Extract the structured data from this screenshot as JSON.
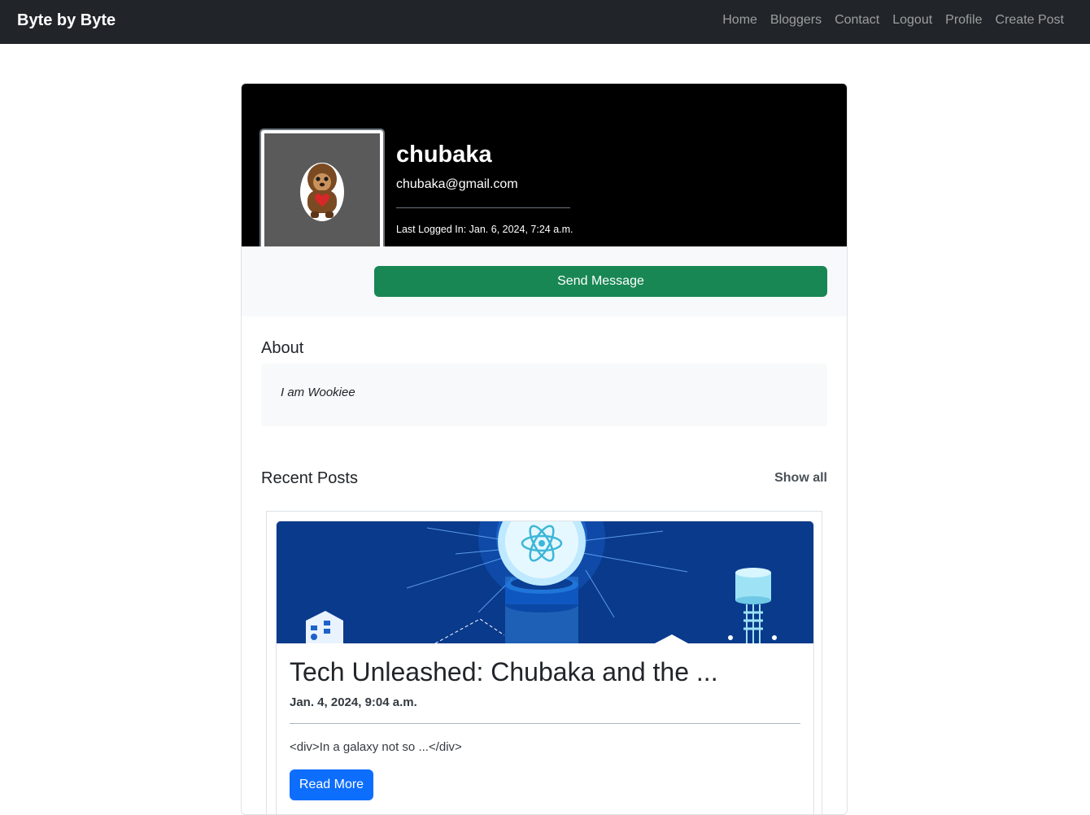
{
  "navbar": {
    "brand": "Byte by Byte",
    "links": [
      "Home",
      "Bloggers",
      "Contact",
      "Logout",
      "Profile",
      "Create Post"
    ]
  },
  "profile": {
    "username": "chubaka",
    "email": "chubaka@gmail.com",
    "last_logged_in": "Last Logged In: Jan. 6, 2024, 7:24 a.m.",
    "avatar_icon": "wookiee-sticker-icon",
    "send_message_label": "Send Message"
  },
  "about": {
    "heading": "About",
    "text": "I am Wookiee"
  },
  "recent_posts": {
    "heading": "Recent Posts",
    "show_all_label": "Show all",
    "posts": [
      {
        "title": "Tech Unleashed: Chubaka and the ...",
        "date": "Jan. 4, 2024, 9:04 a.m.",
        "excerpt": "<div>In a galaxy not so ...</div>",
        "read_more_label": "Read More",
        "image_icon": "tech-illustration"
      }
    ]
  },
  "colors": {
    "navbar_bg": "#212529",
    "success": "#198754",
    "primary": "#0d6efd",
    "post_image_bg": "#0a3a8c"
  }
}
